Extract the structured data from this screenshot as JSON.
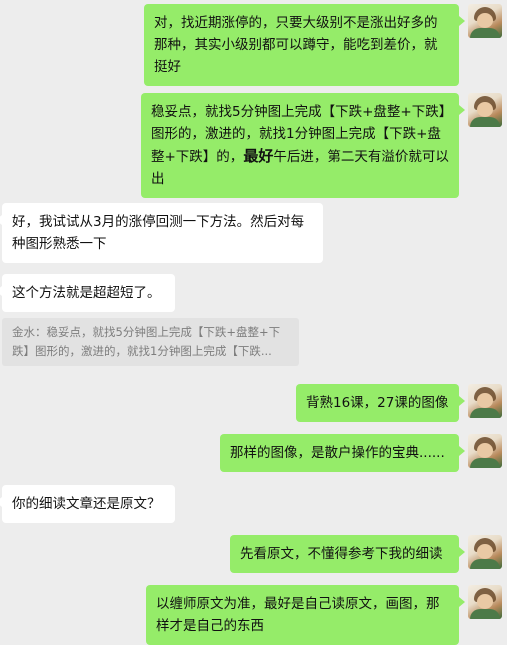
{
  "messages": [
    {
      "text": "对，找近期涨停的，只要大级别不是涨出好多的那种，其实小级别都可以蹲守，能吃到差价，就挺好"
    },
    {
      "text_a": "稳妥点，就找5分钟图上完成【下跌+盘整+下跌】图形的，激进的，就找1分钟图上完成【下跌+盘整+下跌】的，",
      "text_b": "最好",
      "text_c": "午后进，第二天有溢价就可以出"
    },
    {
      "text": "好，我试试从3月的涨停回测一下方法。然后对每种图形熟悉一下"
    },
    {
      "text": "这个方法就是超超短了。"
    },
    {
      "text": "金水：稳妥点，就找5分钟图上完成【下跌+盘整+下跌】图形的，激进的，就找1分钟图上完成【下跌..."
    },
    {
      "text": "背熟16课，27课的图像"
    },
    {
      "text": "那样的图像，是散户操作的宝典......"
    },
    {
      "text": "你的细读文章还是原文？"
    },
    {
      "text": "先看原文，不懂得参考下我的细读"
    },
    {
      "text": "以缠师原文为准，最好是自己读原文，画图，那样才是自己的东西"
    }
  ]
}
